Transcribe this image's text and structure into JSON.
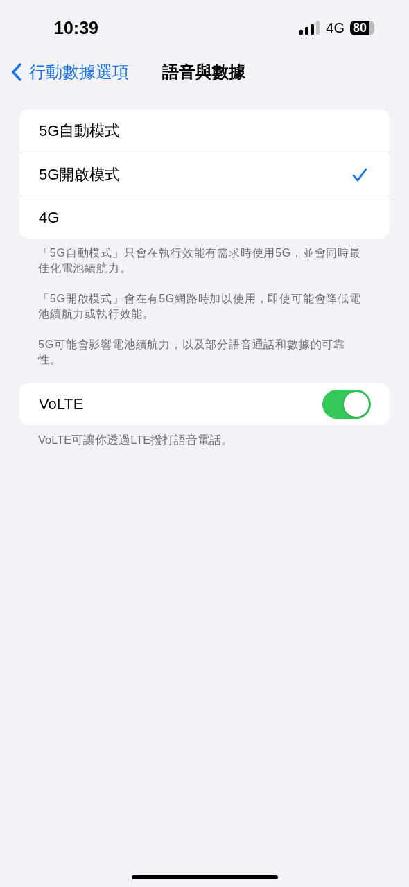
{
  "status_bar": {
    "time": "10:39",
    "network": "4G",
    "battery": "80"
  },
  "nav": {
    "back": "行動數據選項",
    "title": "語音與數據"
  },
  "modes": [
    {
      "label": "5G自動模式",
      "selected": false
    },
    {
      "label": "5G開啟模式",
      "selected": true
    },
    {
      "label": "4G",
      "selected": false
    }
  ],
  "mode_notes": [
    "「5G自動模式」只會在執行效能有需求時使用5G，並會同時最佳化電池續航力。",
    "「5G開啟模式」會在有5G網路時加以使用，即使可能會降低電池續航力或執行效能。",
    "5G可能會影響電池續航力，以及部分語音通話和數據的可靠性。"
  ],
  "volte": {
    "label": "VoLTE",
    "on": true,
    "note": "VoLTE可讓你透過LTE撥打語音電話。"
  }
}
